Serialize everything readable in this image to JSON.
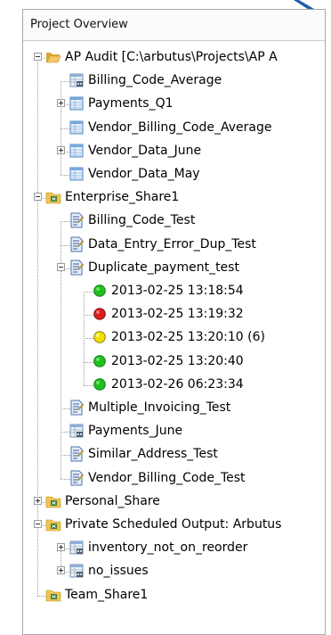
{
  "panel": {
    "title": "Project Overview"
  },
  "colors": {
    "ok": "#1fbf1f",
    "error": "#d91e1e",
    "warning": "#f0e000",
    "accent": "#1f5fa8"
  },
  "tree": [
    {
      "label": "AP Audit [C:\\arbutus\\Projects\\AP A",
      "level": 0,
      "expander": "minus",
      "icon": "open-folder-icon"
    },
    {
      "label": "Billing_Code_Average",
      "level": 1,
      "icon": "table-grey-icon"
    },
    {
      "label": "Payments_Q1",
      "level": 1,
      "expander": "plus",
      "icon": "table-blue-icon"
    },
    {
      "label": "Vendor_Billing_Code_Average",
      "level": 1,
      "icon": "table-blue-icon"
    },
    {
      "label": "Vendor_Data_June",
      "level": 1,
      "expander": "plus",
      "icon": "table-blue-icon"
    },
    {
      "label": "Vendor_Data_May",
      "level": 1,
      "icon": "table-blue-icon"
    },
    {
      "label": "Enterprise_Share1",
      "level": 0,
      "expander": "minus",
      "icon": "share-folder-icon"
    },
    {
      "label": "Billing_Code_Test",
      "level": 1,
      "icon": "script-icon"
    },
    {
      "label": "Data_Entry_Error_Dup_Test",
      "level": 1,
      "icon": "script-icon"
    },
    {
      "label": "Duplicate_payment_test",
      "level": 1,
      "expander": "minus",
      "icon": "script-icon"
    },
    {
      "label": "2013-02-25 13:18:54",
      "level": 2,
      "icon": "status-green-icon"
    },
    {
      "label": "2013-02-25 13:19:32",
      "level": 2,
      "icon": "status-red-icon"
    },
    {
      "label": "2013-02-25 13:20:10 (6)",
      "level": 2,
      "icon": "status-yellow-icon"
    },
    {
      "label": "2013-02-25 13:20:40",
      "level": 2,
      "icon": "status-green-icon"
    },
    {
      "label": "2013-02-26 06:23:34",
      "level": 2,
      "icon": "status-green-icon"
    },
    {
      "label": "Multiple_Invoicing_Test",
      "level": 1,
      "icon": "script-icon"
    },
    {
      "label": "Payments_June",
      "level": 1,
      "icon": "table-grey-icon"
    },
    {
      "label": "Similar_Address_Test",
      "level": 1,
      "icon": "script-icon"
    },
    {
      "label": "Vendor_Billing_Code_Test",
      "level": 1,
      "icon": "script-icon"
    },
    {
      "label": "Personal_Share",
      "level": 0,
      "expander": "plus",
      "icon": "share-folder-icon"
    },
    {
      "label": "Private Scheduled Output:  Arbutus",
      "level": 0,
      "expander": "minus",
      "icon": "share-folder-icon"
    },
    {
      "label": "inventory_not_on_reorder",
      "level": 1,
      "expander": "plus",
      "icon": "table-grey-icon"
    },
    {
      "label": "no_issues",
      "level": 1,
      "expander": "plus",
      "icon": "table-grey-icon"
    },
    {
      "label": "Team_Share1",
      "level": 0,
      "icon": "share-folder-icon"
    }
  ]
}
